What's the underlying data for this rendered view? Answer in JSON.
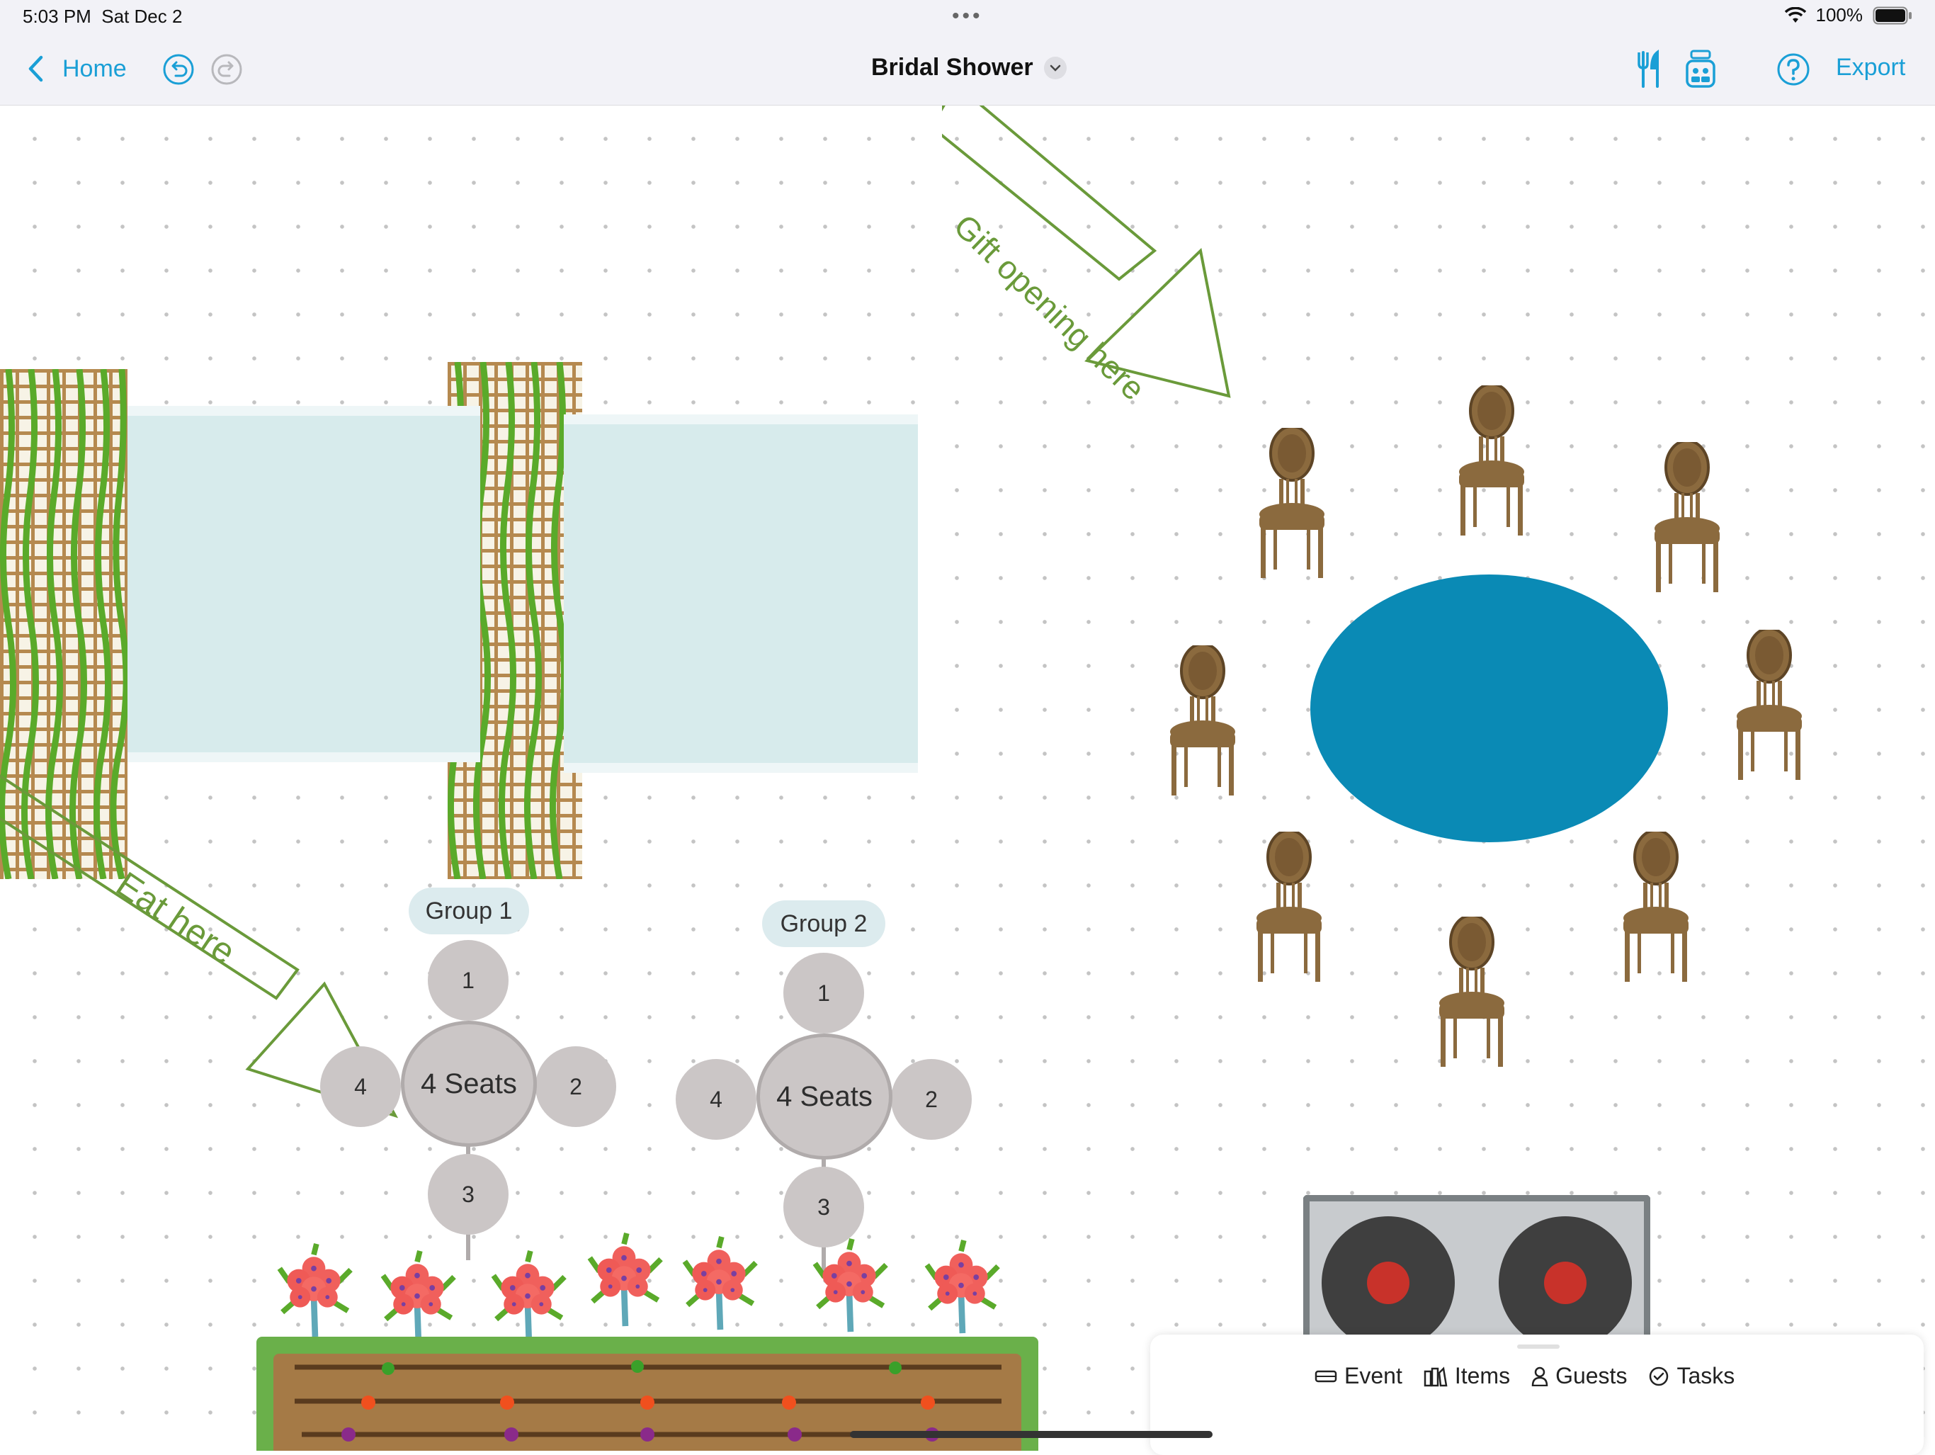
{
  "status": {
    "time": "5:03 PM",
    "date": "Sat Dec 2",
    "battery": "100%"
  },
  "nav": {
    "back_label": "Home",
    "title": "Bridal Shower",
    "export_label": "Export"
  },
  "canvas": {
    "annotations": [
      "Gift opening here",
      "Eat here"
    ],
    "tables": [
      {
        "group": "Group 1",
        "center": "4 Seats",
        "seats": [
          "1",
          "2",
          "3",
          "4"
        ]
      },
      {
        "group": "Group 2",
        "center": "4 Seats",
        "seats": [
          "1",
          "2",
          "3",
          "4"
        ]
      }
    ]
  },
  "bottom_tabs": [
    "Event",
    "Items",
    "Guests",
    "Tasks"
  ],
  "colors": {
    "accent": "#1a9fd6",
    "arrow": "#6a9a3a",
    "round_table": "#0a8ab5",
    "chair": "#8b6a3e",
    "seat": "#cbc6c6",
    "water": "#d7ebec"
  }
}
